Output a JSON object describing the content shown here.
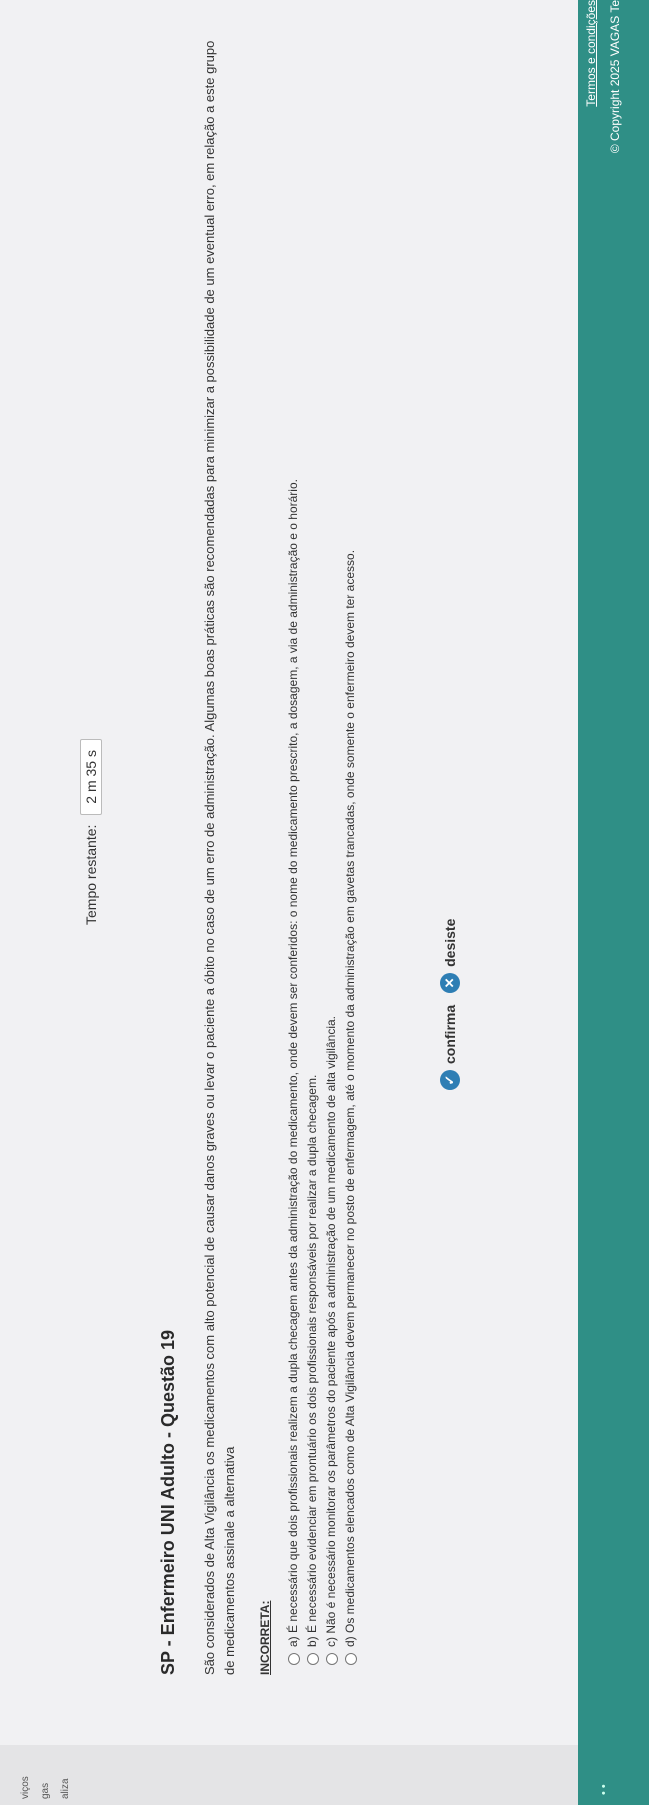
{
  "sidebar_fragments": [
    "viços",
    "gas",
    "aliza"
  ],
  "timer": {
    "label": "Tempo restante:",
    "value": "2 m 35 s"
  },
  "question": {
    "title": "SP - Enfermeiro UNI Adulto - Questão 19",
    "statement": "São considerados de Alta Vigilância os medicamentos com alto potencial de causar danos graves ou levar o paciente a óbito no caso de um erro de administração. Algumas boas práticas são recomendadas para minimizar a possibilidade de um eventual erro, em relação a este grupo de medicamentos assinale a alternativa",
    "emphasis": "INCORRETA:",
    "options": [
      "a) É necessário que dois profissionais realizem a dupla checagem antes da administração do medicamento, onde devem ser conferidos: o nome do medicamento prescrito, a dosagem, a via de administração e o horário.",
      "b) É necessário evidenciar em prontuário os dois profissionais responsáveis por realizar a dupla checagem.",
      "c) Não é necessário monitorar os parâmetros do paciente após a administração de um medicamento de alta vigilância.",
      "d) Os medicamentos elencados como de Alta Vigilância devem permanecer no posto de enfermagem, até o momento da administração em gavetas trancadas, onde somente o enfermeiro devem ter acesso."
    ]
  },
  "actions": {
    "confirm": "confirma",
    "cancel": "desiste"
  },
  "footer": {
    "terms": "Termos e condições",
    "copyright": "© Copyright 2025 VAGAS Te"
  },
  "colors": {
    "footer": "#2f8f86",
    "button_icon": "#2e7eb4"
  }
}
